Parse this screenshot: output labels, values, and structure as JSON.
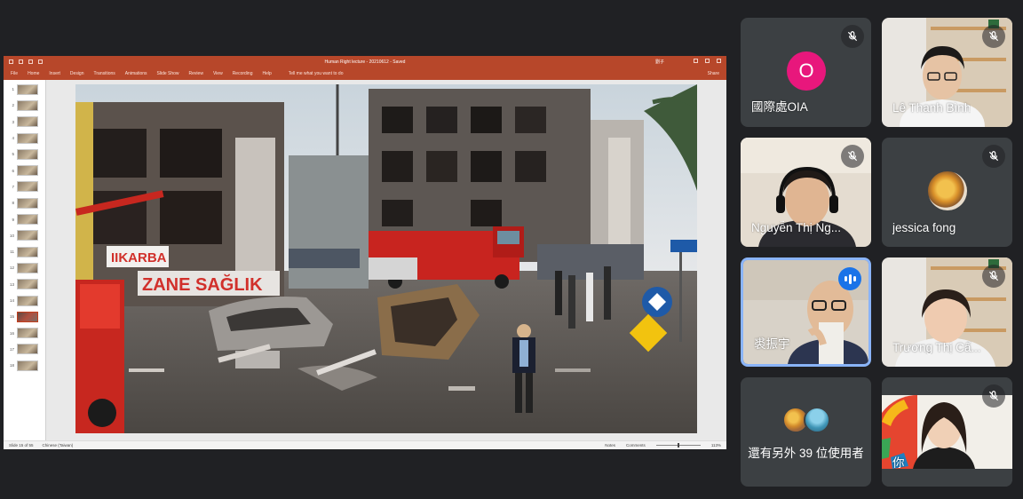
{
  "ppt": {
    "window_title": "Human Right lecture - 20210612 - Saved",
    "user": "劉子",
    "tabs": [
      "File",
      "Home",
      "Insert",
      "Design",
      "Transitions",
      "Animations",
      "Slide Show",
      "Review",
      "View",
      "Recording",
      "Help"
    ],
    "tell_me": "Tell me what you want to do",
    "share": "Share",
    "slide_numbers": [
      "1",
      "2",
      "3",
      "4",
      "5",
      "6",
      "7",
      "8",
      "9",
      "10",
      "11",
      "12",
      "13",
      "14",
      "15",
      "16",
      "17",
      "18"
    ],
    "active_slide": "15",
    "status_left": "Slide 15 of 55",
    "status_lang": "Chinese (Taiwan)",
    "status_notes": "Notes",
    "status_comments": "Comments",
    "zoom": "113%"
  },
  "participants": [
    {
      "name": "國際處OIA",
      "avatar_letter": "O",
      "avatar_color": "#e8177c",
      "muted": true
    },
    {
      "name": "Lê Thanh Bình",
      "muted": true
    },
    {
      "name": "Nguyễn Thị Ng...",
      "muted": true
    },
    {
      "name": "jessica fong",
      "muted": true
    },
    {
      "name": "裘振宇",
      "speaking": true
    },
    {
      "name": "Trương Thị Cẩ...",
      "muted": true
    },
    {
      "more_label": "還有另外 39 位使用者"
    },
    {
      "name": "你",
      "muted": true
    }
  ]
}
